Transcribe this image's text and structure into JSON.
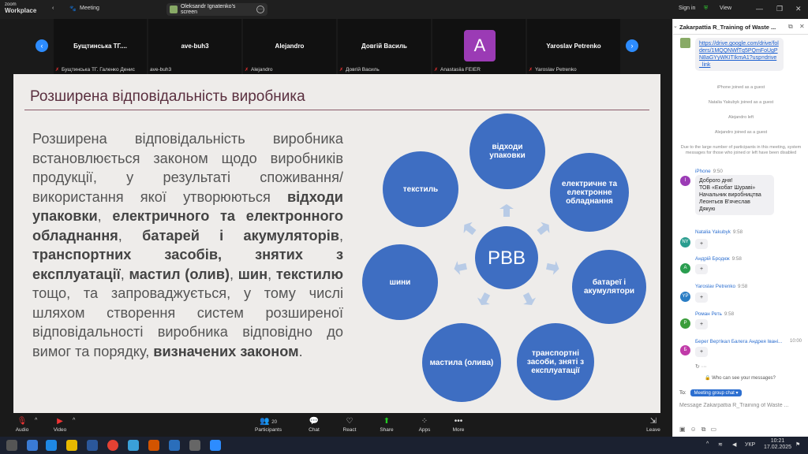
{
  "app": {
    "brand_top": "zoom",
    "brand_bottom": "Workplace",
    "meeting_label": "Meeting",
    "screen_share_label": "Oleksandr Ignatenko's screen"
  },
  "topbar_right": {
    "sign_in": "Sign in",
    "view": "View"
  },
  "participants": [
    {
      "name": "Бущтинська ТГ....",
      "sub": "Бущтинська ТГ. Галенко Денис"
    },
    {
      "name": "ave-buh3",
      "sub": "ave-buh3"
    },
    {
      "name": "Alejandro",
      "sub": "Alejandro"
    },
    {
      "name": "Довгій Василь",
      "sub": "Довгій Василь"
    },
    {
      "name": "A",
      "sub": "Anastasiia FEIER"
    },
    {
      "name": "Yaroslav Petrenko",
      "sub": "Yaroslav Petrenko"
    }
  ],
  "slide": {
    "title": "Розширена відповідальність виробника",
    "body_parts": [
      {
        "t": "Розширена відповідальність виробника встановлюється законом щодо виробників продукції, у результаті споживання/використання якої утворюються ",
        "b": false
      },
      {
        "t": "відходи упаковки",
        "b": true
      },
      {
        "t": ", ",
        "b": false
      },
      {
        "t": "електричного та електронного обладнання",
        "b": true
      },
      {
        "t": ", ",
        "b": false
      },
      {
        "t": "батарей і акумуляторів",
        "b": true
      },
      {
        "t": ", ",
        "b": false
      },
      {
        "t": "транспортних засобів, знятих з експлуатації",
        "b": true
      },
      {
        "t": ", ",
        "b": false
      },
      {
        "t": "мастил (олив)",
        "b": true
      },
      {
        "t": ", ",
        "b": false
      },
      {
        "t": "шин",
        "b": true
      },
      {
        "t": ", ",
        "b": false
      },
      {
        "t": "текстилю",
        "b": true
      },
      {
        "t": " тощо, та запроваджується, у тому числі шляхом створення систем розширеної відповідальності виробника відповідно до вимог та порядку, ",
        "b": false
      },
      {
        "t": "визначених законом",
        "b": true
      },
      {
        "t": ".",
        "b": false
      }
    ],
    "center": "РВВ",
    "nodes": [
      "відходи упаковки",
      "електричне та електронне обладнання",
      "батареї і акумулятори",
      "транспортні засоби, зняті з експлуатації",
      "мастила (олива)",
      "шини",
      "текстиль"
    ],
    "node_color": "#3e6ec2",
    "arrow_color": "#b8cbe6"
  },
  "toolbar": {
    "audio": "Audio",
    "video": "Video",
    "participants": "Participants",
    "participants_count": "20",
    "chat": "Chat",
    "react": "React",
    "share": "Share",
    "apps": "Apps",
    "more": "More",
    "leave": "Leave"
  },
  "chat": {
    "title": "Zakarpattia R_Training of Waste ...",
    "link": "https://drive.google.com/drive/folders/1MQQNWfTq5PQmFoUgPN8aGYyWKITIkmA1?usp=drive_link",
    "sys1": "iPhone joined as a guest",
    "sys2": "Natalia Yakubyk joined as a guest",
    "sys3": "Alejandro left",
    "sys4": "Alejandro joined as a guest",
    "sys5": "Due to the large number of participants in this meeting, system messages for those who joined or left have been disabled",
    "msg1_sender": "iPhone",
    "msg1_time": "9:50",
    "msg1_text": "Доброго дня!\nТОВ «Екобат Шураві»\nНачальник виробництва\nЛеонтьєв В'ячеслав\nДякую",
    "m2_sender": "Natalia Yakubyk",
    "m2_time": "9:58",
    "m2_av": "NY",
    "m3_sender": "Андрій Бродюк",
    "m3_time": "9:58",
    "m3_av": "А",
    "m4_sender": "Yaroslav Petrenko",
    "m4_time": "9:58",
    "m4_av": "YP",
    "m5_sender": "Роман Реть",
    "m5_time": "9:58",
    "m5_av": "Р",
    "m6_sender": "Берег Вертікал Балега Андрея Івані...",
    "m6_time": "10:00",
    "m6_av": "Б",
    "plus": "+",
    "who_can_see": "Who can see your messages?",
    "to_label": "To:",
    "to_value": "Meeting group chat",
    "input_placeholder": "Message Zakarpattia R_Training of Waste ..."
  },
  "taskbar": {
    "lang": "УКР",
    "time": "10:21",
    "date": "17.02.2025"
  }
}
